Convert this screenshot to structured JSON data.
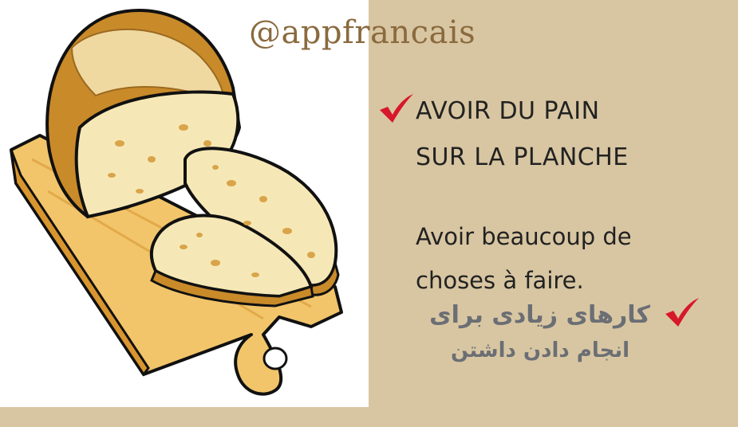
{
  "watermark": "@appfrancais",
  "expression": {
    "line1": "AVOIR DU PAIN",
    "line2": "SUR LA PLANCHE"
  },
  "meaning_fr": {
    "line1": "Avoir beaucoup de",
    "line2": "choses à faire."
  },
  "meaning_fa": {
    "line1": "کارهای زیادی برای",
    "line2": "انجام دادن داشتن"
  },
  "colors": {
    "background": "#d8c6a2",
    "check": "#d7182a",
    "persian_text": "#6b6e74",
    "watermark": "#8a6a3e"
  },
  "icons": [
    "red-checkmark-icon",
    "bread-on-cutting-board-illustration"
  ]
}
